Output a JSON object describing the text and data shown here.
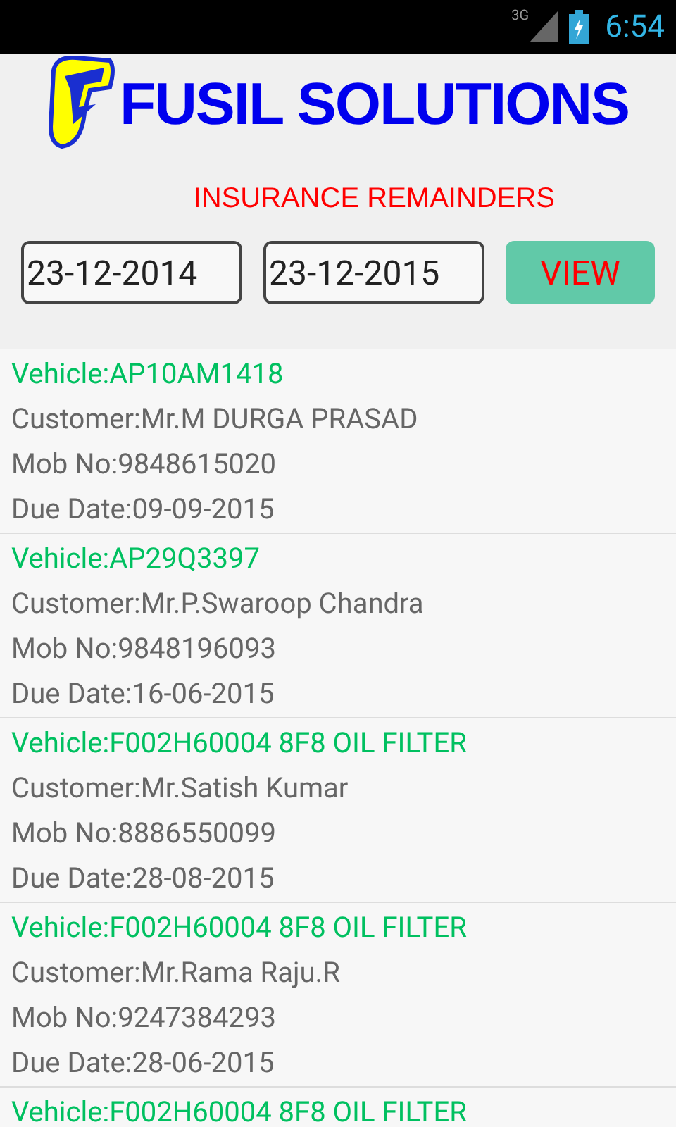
{
  "status_bar": {
    "network": "3G",
    "time": "6:54"
  },
  "header": {
    "brand": "FUSIL SOLUTIONS",
    "subtitle": "INSURANCE REMAINDERS"
  },
  "filters": {
    "from_date": "23-12-2014",
    "to_date": "23-12-2015",
    "button": "VIEW"
  },
  "records": [
    {
      "vehicle": "Vehicle:AP10AM1418",
      "customer": "Customer:Mr.M DURGA PRASAD",
      "mobile": "Mob No:9848615020",
      "due_date": "Due Date:09-09-2015"
    },
    {
      "vehicle": "Vehicle:AP29Q3397",
      "customer": "Customer:Mr.P.Swaroop Chandra",
      "mobile": "Mob No:9848196093",
      "due_date": "Due Date:16-06-2015"
    },
    {
      "vehicle": "Vehicle:F002H60004 8F8 OIL FILTER",
      "customer": "Customer:Mr.Satish Kumar",
      "mobile": "Mob No:8886550099",
      "due_date": "Due Date:28-08-2015"
    },
    {
      "vehicle": "Vehicle:F002H60004 8F8 OIL FILTER",
      "customer": "Customer:Mr.Rama Raju.R",
      "mobile": "Mob No:9247384293",
      "due_date": "Due Date:28-06-2015"
    },
    {
      "vehicle": "Vehicle:F002H60004 8F8 OIL FILTER"
    }
  ]
}
